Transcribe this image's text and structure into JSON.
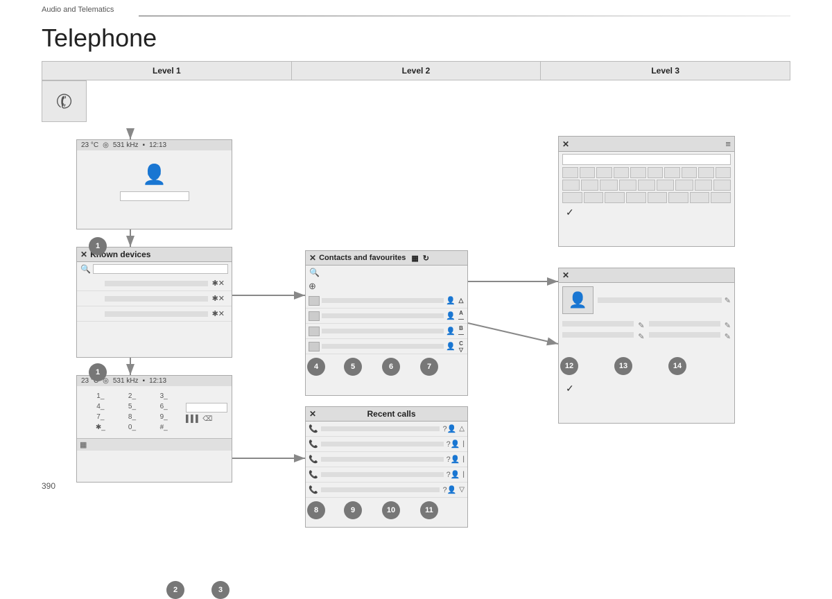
{
  "topBar": {
    "section": "Audio and Telematics"
  },
  "pageTitle": "Telephone",
  "levels": {
    "level1": "Level 1",
    "level2": "Level 2",
    "level3": "Level 3"
  },
  "statusBar": {
    "temp": "23 °C",
    "freq": "531 kHz",
    "time": "12:13"
  },
  "knownDevices": {
    "title": "Known devices"
  },
  "contactsFavourites": {
    "title": "Contacts and favourites"
  },
  "recentCalls": {
    "title": "Recent calls"
  },
  "badges": {
    "b1a": "1",
    "b1b": "1",
    "b2": "2",
    "b3": "3",
    "b4": "4",
    "b5": "5",
    "b6": "6",
    "b7": "7",
    "b8": "8",
    "b9": "9",
    "b10": "10",
    "b11": "11",
    "b12": "12",
    "b13": "13",
    "b14": "14"
  },
  "keypad": {
    "keys": [
      "1_",
      "2_",
      "3_",
      "4_",
      "5_",
      "6_",
      "7_",
      "8_",
      "9_",
      "✱_",
      "0_",
      "#_"
    ]
  },
  "pageNumber": "390"
}
